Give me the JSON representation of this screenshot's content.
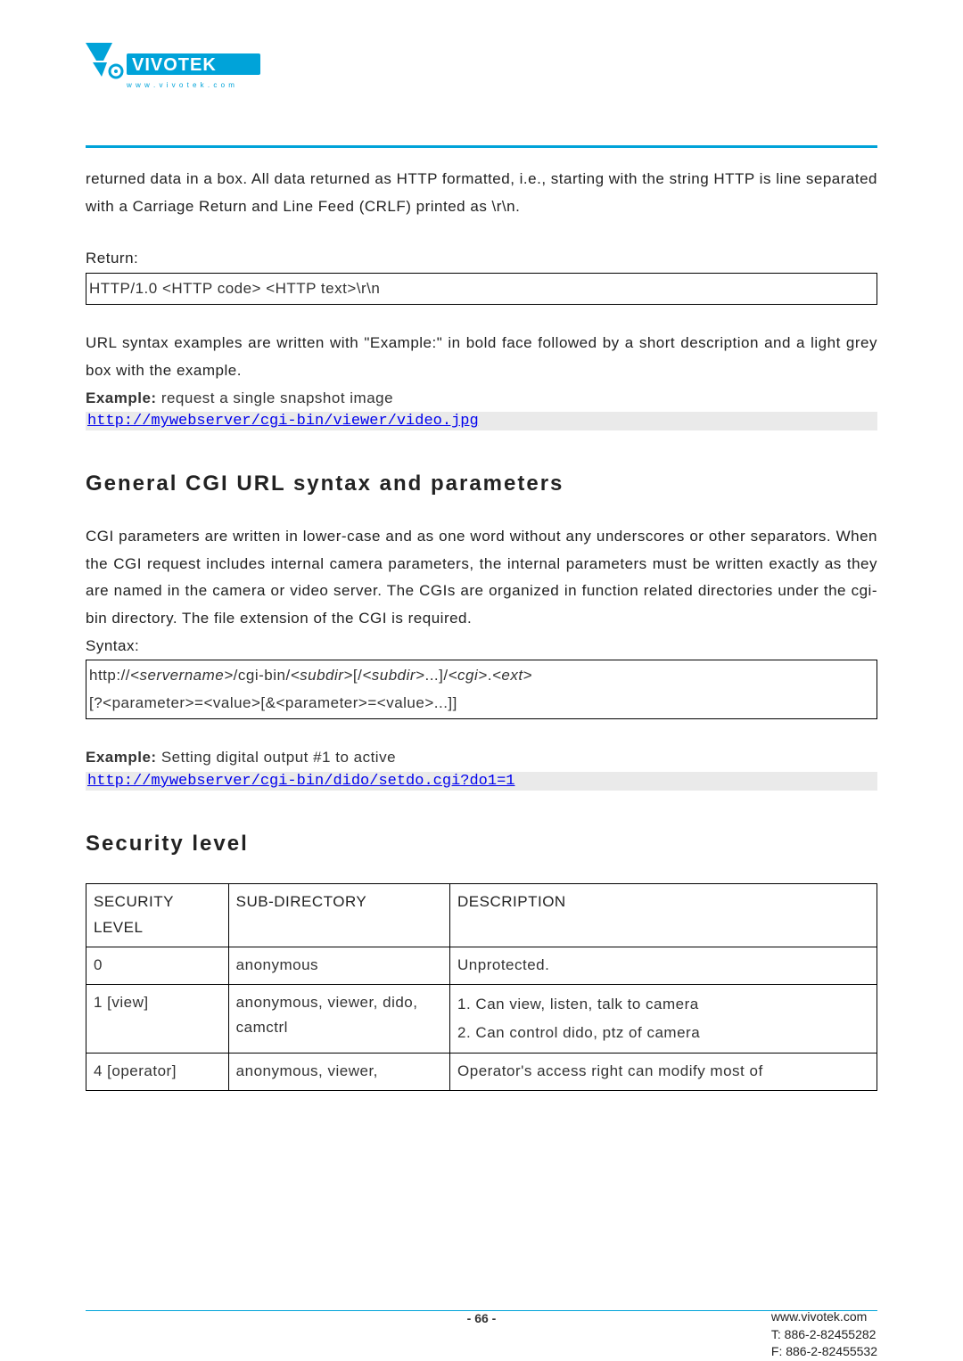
{
  "logo": {
    "brand": "VIVOTEK",
    "sub": "w w w . v i v o t e k . c o m"
  },
  "para_intro": "returned data in a box. All data returned as HTTP formatted, i.e., starting with the string HTTP is line separated with a Carriage Return and Line Feed (CRLF) printed as \\r\\n.",
  "return_label": "Return:",
  "return_box": "HTTP/1.0 <HTTP code> <HTTP text>\\r\\n",
  "para_url_examples": "URL syntax examples are written with \"Example:\" in bold face followed by a short description and a light grey box with the example.",
  "example1_prefix": "Example:",
  "example1_text": " request a single snapshot image",
  "example1_url": "http://mywebserver/cgi-bin/viewer/video.jpg",
  "heading_general": "General CGI URL syntax and parameters",
  "para_general": "CGI parameters are written in lower-case and as one word without any underscores or other separators. When the CGI request includes internal camera parameters, the internal parameters must be written exactly as they are named in the camera or video server. The CGIs are organized in function related directories under the cgi-bin directory. The file extension of the CGI is required.",
  "syntax_label": "Syntax:",
  "syntax_line1_pre": "http://",
  "syntax_line1_s1": "<servername>",
  "syntax_line1_mid1": "/cgi-bin/",
  "syntax_line1_s2": "<subdir>",
  "syntax_line1_mid2": "[/",
  "syntax_line1_s3": "<subdir>",
  "syntax_line1_mid3": "...]/",
  "syntax_line1_s4": "<cgi>",
  "syntax_line1_mid4": ".",
  "syntax_line1_s5": "<ext>",
  "syntax_line2": "[?<parameter>=<value>[&<parameter>=<value>...]]",
  "example2_prefix": "Example:",
  "example2_text": " Setting digital output #1 to active",
  "example2_url": "http://mywebserver/cgi-bin/dido/setdo.cgi?do1=1",
  "heading_security": "Security level",
  "table": {
    "headers": [
      "SECURITY LEVEL",
      "SUB-DIRECTORY",
      "DESCRIPTION"
    ],
    "rows": [
      {
        "level": "0",
        "sub": "anonymous",
        "desc": "Unprotected."
      },
      {
        "level": "1 [view]",
        "sub": "anonymous, viewer, dido, camctrl",
        "desc_lines": [
          "1. Can view, listen, talk to camera",
          "2. Can control dido, ptz of camera"
        ]
      },
      {
        "level": "4 [operator]",
        "sub": "anonymous, viewer,",
        "desc": "Operator's access right can modify most of"
      }
    ]
  },
  "page_number": "- 66 -",
  "footer_contact": {
    "site": "www.vivotek.com",
    "tel": "T: 886-2-82455282",
    "fax": "F: 886-2-82455532"
  }
}
